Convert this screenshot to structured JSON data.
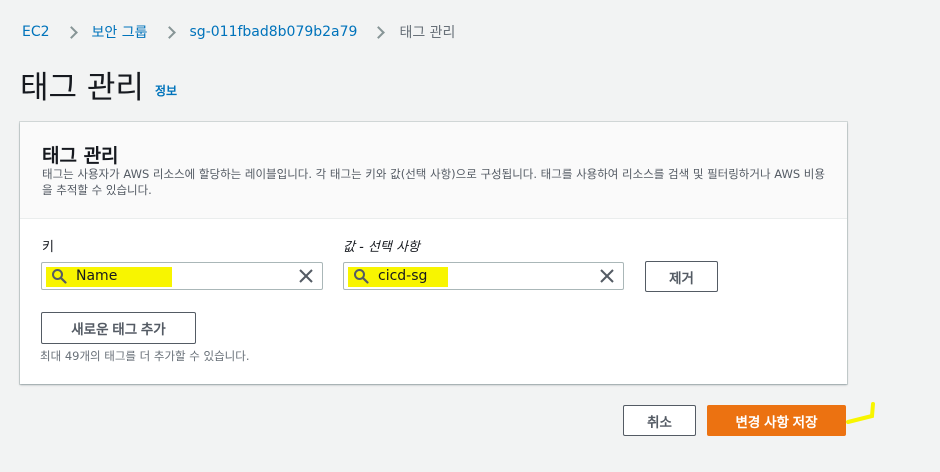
{
  "breadcrumb": {
    "items": [
      {
        "label": "EC2"
      },
      {
        "label": "보안 그룹"
      },
      {
        "label": "sg-011fbad8b079b2a79"
      },
      {
        "label": "태그 관리"
      }
    ]
  },
  "page": {
    "title": "태그 관리",
    "info_link": "정보"
  },
  "panel": {
    "title": "태그 관리",
    "description": "태그는 사용자가 AWS 리소스에 할당하는 레이블입니다. 각 태그는 키와 값(선택 사항)으로 구성됩니다. 태그를 사용하여 리소스를 검색 및 필터링하거나 AWS 비용을 추적할 수 있습니다.",
    "key_label": "키",
    "value_label": "값 - 선택 사항",
    "tag": {
      "key": "Name",
      "value": "cicd-sg"
    },
    "remove_label": "제거",
    "add_tag_label": "새로운 태그 추가",
    "hint": "최대 49개의 태그를 더 추가할 수 있습니다."
  },
  "footer": {
    "cancel_label": "취소",
    "save_label": "변경 사항 저장"
  },
  "colors": {
    "accent": "#ec7211",
    "link": "#0073bb",
    "highlight": "#f8f500"
  },
  "icons": [
    "chevron-right-icon",
    "search-icon",
    "close-icon"
  ]
}
